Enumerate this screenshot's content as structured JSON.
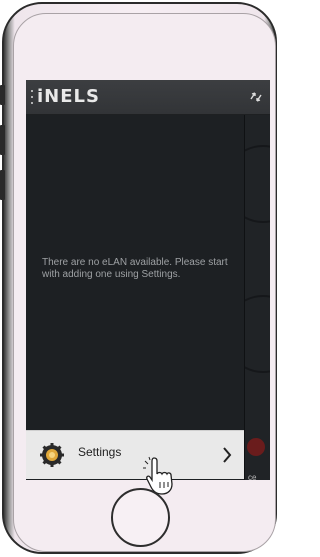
{
  "app": {
    "brand": "iNELS",
    "header_icon": "switch-arrows-icon"
  },
  "drawer": {
    "empty_message": "There are no eLAN available. Please start with adding one using Settings.",
    "settings_label": "Settings",
    "settings_icon": "gear-icon",
    "chevron_icon": "chevron-right-icon"
  },
  "background": {
    "partial_label": "ce"
  },
  "colors": {
    "screen_bg": "#2d2f31",
    "drawer_bg": "#1d2023",
    "settings_bg": "#e9e9e9",
    "phone_frame": "#f4ecf1"
  }
}
